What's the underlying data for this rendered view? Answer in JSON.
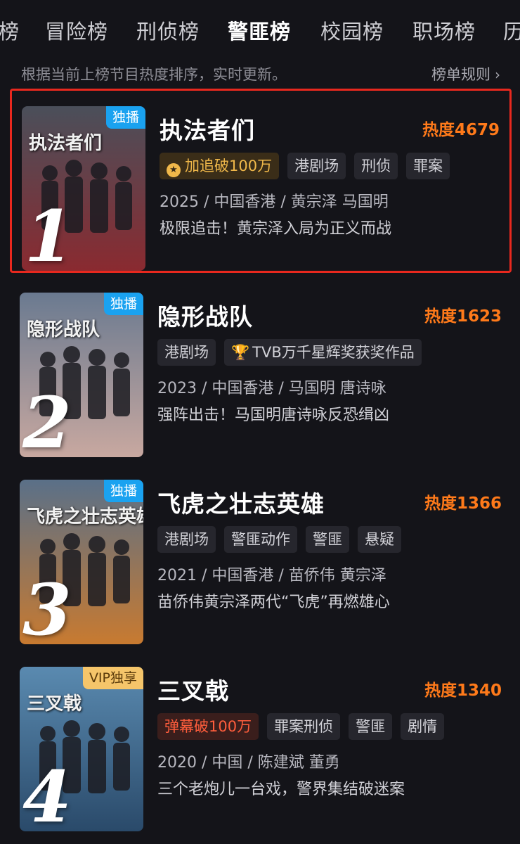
{
  "tabs": [
    {
      "label": "榜",
      "active": false
    },
    {
      "label": "冒险榜",
      "active": false
    },
    {
      "label": "刑侦榜",
      "active": false
    },
    {
      "label": "警匪榜",
      "active": true
    },
    {
      "label": "校园榜",
      "active": false
    },
    {
      "label": "职场榜",
      "active": false
    },
    {
      "label": "历",
      "active": false
    }
  ],
  "subhead": {
    "text": "根据当前上榜节目热度排序，实时更新。",
    "rules_label": "榜单规则",
    "rules_icon": "chevron-right-icon"
  },
  "items": [
    {
      "rank": "1",
      "title": "执法者们",
      "heat": "热度4679",
      "badge": "独播",
      "badge_type": "exclusive",
      "poster_text": "执法者们",
      "tags": [
        {
          "label": "加追破100万",
          "style": "gold",
          "icon": "star-icon"
        },
        {
          "label": "港剧场",
          "style": "normal"
        },
        {
          "label": "刑侦",
          "style": "normal"
        },
        {
          "label": "罪案",
          "style": "normal"
        }
      ],
      "meta": "2025 / 中国香港 / 黄宗泽 马国明",
      "desc": "极限追击！黄宗泽入局为正义而战",
      "highlighted": true,
      "colors": {
        "top": "#4a4f5a",
        "bottom": "#8a2a30"
      }
    },
    {
      "rank": "2",
      "title": "隐形战队",
      "heat": "热度1623",
      "badge": "独播",
      "badge_type": "exclusive",
      "poster_text": "隐形战队",
      "tags": [
        {
          "label": "港剧场",
          "style": "normal"
        },
        {
          "label": "TVB万千星辉奖获奖作品",
          "style": "normal",
          "icon": "trophy-icon"
        }
      ],
      "meta": "2023 / 中国香港 / 马国明 唐诗咏",
      "desc": "强阵出击！马国明唐诗咏反恐缉凶",
      "highlighted": false,
      "colors": {
        "top": "#6a7a90",
        "bottom": "#c8a8a0"
      }
    },
    {
      "rank": "3",
      "title": "飞虎之壮志英雄",
      "heat": "热度1366",
      "badge": "独播",
      "badge_type": "exclusive",
      "poster_text": "飞虎之壮志英雄",
      "tags": [
        {
          "label": "港剧场",
          "style": "normal"
        },
        {
          "label": "警匪动作",
          "style": "normal"
        },
        {
          "label": "警匪",
          "style": "normal"
        },
        {
          "label": "悬疑",
          "style": "normal"
        }
      ],
      "meta": "2021 / 中国香港 / 苗侨伟 黄宗泽",
      "desc": "苗侨伟黄宗泽两代“飞虎”再燃雄心",
      "highlighted": false,
      "colors": {
        "top": "#5a7088",
        "bottom": "#c87a30"
      }
    },
    {
      "rank": "4",
      "title": "三叉戟",
      "heat": "热度1340",
      "badge": "VIP独享",
      "badge_type": "vip",
      "poster_text": "三叉戟",
      "tags": [
        {
          "label": "弹幕破100万",
          "style": "red"
        },
        {
          "label": "罪案刑侦",
          "style": "normal"
        },
        {
          "label": "警匪",
          "style": "normal"
        },
        {
          "label": "剧情",
          "style": "normal"
        }
      ],
      "meta": "2020 / 中国 / 陈建斌 董勇",
      "desc": "三个老炮儿一台戏，警界集结破迷案",
      "highlighted": false,
      "colors": {
        "top": "#5a8ab0",
        "bottom": "#2a4a6a"
      }
    }
  ]
}
